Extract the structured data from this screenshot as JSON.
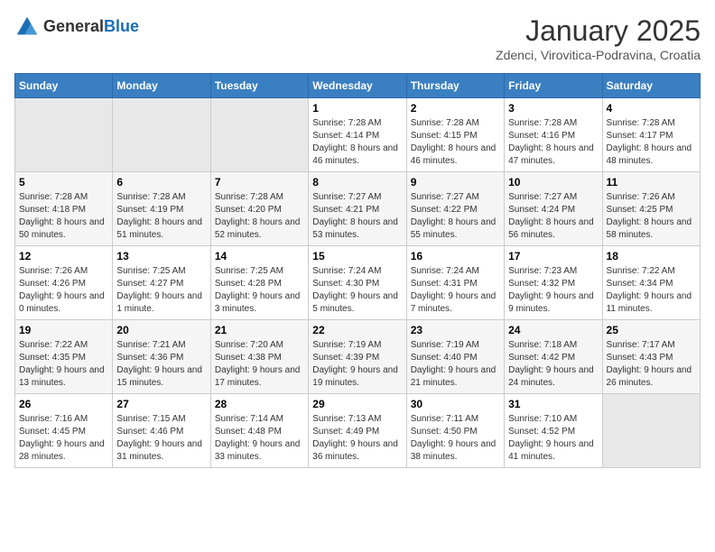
{
  "logo": {
    "general": "General",
    "blue": "Blue"
  },
  "header": {
    "month": "January 2025",
    "location": "Zdenci, Virovitica-Podravina, Croatia"
  },
  "days_of_week": [
    "Sunday",
    "Monday",
    "Tuesday",
    "Wednesday",
    "Thursday",
    "Friday",
    "Saturday"
  ],
  "weeks": [
    [
      {
        "day": "",
        "info": ""
      },
      {
        "day": "",
        "info": ""
      },
      {
        "day": "",
        "info": ""
      },
      {
        "day": "1",
        "info": "Sunrise: 7:28 AM\nSunset: 4:14 PM\nDaylight: 8 hours and 46 minutes."
      },
      {
        "day": "2",
        "info": "Sunrise: 7:28 AM\nSunset: 4:15 PM\nDaylight: 8 hours and 46 minutes."
      },
      {
        "day": "3",
        "info": "Sunrise: 7:28 AM\nSunset: 4:16 PM\nDaylight: 8 hours and 47 minutes."
      },
      {
        "day": "4",
        "info": "Sunrise: 7:28 AM\nSunset: 4:17 PM\nDaylight: 8 hours and 48 minutes."
      }
    ],
    [
      {
        "day": "5",
        "info": "Sunrise: 7:28 AM\nSunset: 4:18 PM\nDaylight: 8 hours and 50 minutes."
      },
      {
        "day": "6",
        "info": "Sunrise: 7:28 AM\nSunset: 4:19 PM\nDaylight: 8 hours and 51 minutes."
      },
      {
        "day": "7",
        "info": "Sunrise: 7:28 AM\nSunset: 4:20 PM\nDaylight: 8 hours and 52 minutes."
      },
      {
        "day": "8",
        "info": "Sunrise: 7:27 AM\nSunset: 4:21 PM\nDaylight: 8 hours and 53 minutes."
      },
      {
        "day": "9",
        "info": "Sunrise: 7:27 AM\nSunset: 4:22 PM\nDaylight: 8 hours and 55 minutes."
      },
      {
        "day": "10",
        "info": "Sunrise: 7:27 AM\nSunset: 4:24 PM\nDaylight: 8 hours and 56 minutes."
      },
      {
        "day": "11",
        "info": "Sunrise: 7:26 AM\nSunset: 4:25 PM\nDaylight: 8 hours and 58 minutes."
      }
    ],
    [
      {
        "day": "12",
        "info": "Sunrise: 7:26 AM\nSunset: 4:26 PM\nDaylight: 9 hours and 0 minutes."
      },
      {
        "day": "13",
        "info": "Sunrise: 7:25 AM\nSunset: 4:27 PM\nDaylight: 9 hours and 1 minute."
      },
      {
        "day": "14",
        "info": "Sunrise: 7:25 AM\nSunset: 4:28 PM\nDaylight: 9 hours and 3 minutes."
      },
      {
        "day": "15",
        "info": "Sunrise: 7:24 AM\nSunset: 4:30 PM\nDaylight: 9 hours and 5 minutes."
      },
      {
        "day": "16",
        "info": "Sunrise: 7:24 AM\nSunset: 4:31 PM\nDaylight: 9 hours and 7 minutes."
      },
      {
        "day": "17",
        "info": "Sunrise: 7:23 AM\nSunset: 4:32 PM\nDaylight: 9 hours and 9 minutes."
      },
      {
        "day": "18",
        "info": "Sunrise: 7:22 AM\nSunset: 4:34 PM\nDaylight: 9 hours and 11 minutes."
      }
    ],
    [
      {
        "day": "19",
        "info": "Sunrise: 7:22 AM\nSunset: 4:35 PM\nDaylight: 9 hours and 13 minutes."
      },
      {
        "day": "20",
        "info": "Sunrise: 7:21 AM\nSunset: 4:36 PM\nDaylight: 9 hours and 15 minutes."
      },
      {
        "day": "21",
        "info": "Sunrise: 7:20 AM\nSunset: 4:38 PM\nDaylight: 9 hours and 17 minutes."
      },
      {
        "day": "22",
        "info": "Sunrise: 7:19 AM\nSunset: 4:39 PM\nDaylight: 9 hours and 19 minutes."
      },
      {
        "day": "23",
        "info": "Sunrise: 7:19 AM\nSunset: 4:40 PM\nDaylight: 9 hours and 21 minutes."
      },
      {
        "day": "24",
        "info": "Sunrise: 7:18 AM\nSunset: 4:42 PM\nDaylight: 9 hours and 24 minutes."
      },
      {
        "day": "25",
        "info": "Sunrise: 7:17 AM\nSunset: 4:43 PM\nDaylight: 9 hours and 26 minutes."
      }
    ],
    [
      {
        "day": "26",
        "info": "Sunrise: 7:16 AM\nSunset: 4:45 PM\nDaylight: 9 hours and 28 minutes."
      },
      {
        "day": "27",
        "info": "Sunrise: 7:15 AM\nSunset: 4:46 PM\nDaylight: 9 hours and 31 minutes."
      },
      {
        "day": "28",
        "info": "Sunrise: 7:14 AM\nSunset: 4:48 PM\nDaylight: 9 hours and 33 minutes."
      },
      {
        "day": "29",
        "info": "Sunrise: 7:13 AM\nSunset: 4:49 PM\nDaylight: 9 hours and 36 minutes."
      },
      {
        "day": "30",
        "info": "Sunrise: 7:11 AM\nSunset: 4:50 PM\nDaylight: 9 hours and 38 minutes."
      },
      {
        "day": "31",
        "info": "Sunrise: 7:10 AM\nSunset: 4:52 PM\nDaylight: 9 hours and 41 minutes."
      },
      {
        "day": "",
        "info": ""
      }
    ]
  ]
}
